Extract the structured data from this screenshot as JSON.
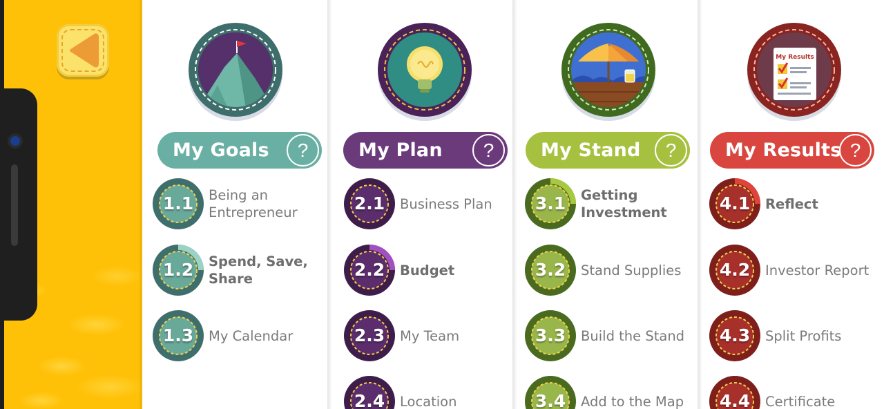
{
  "colors": {
    "sidebar_bg": "#ffc107",
    "back_button": "#fbe36b",
    "back_arrow": "#ec9b35",
    "goals": "#6aafa3",
    "plan": "#6b3a7a",
    "stand": "#a6c03f",
    "results": "#d9463f"
  },
  "sidebar": {
    "back_icon": "triangle-left-icon"
  },
  "sections": [
    {
      "title": "My Goals",
      "help_label": "?",
      "badge_icon": "mountain-flag-icon",
      "lessons": [
        {
          "number": "1.1",
          "label": "Being an Entrepreneur",
          "bold": false,
          "progress": 0
        },
        {
          "number": "1.2",
          "label": "Spend, Save, Share",
          "bold": true,
          "progress": 0.25
        },
        {
          "number": "1.3",
          "label": "My Calendar",
          "bold": false,
          "progress": 0
        }
      ]
    },
    {
      "title": "My Plan",
      "help_label": "?",
      "badge_icon": "lightbulb-icon",
      "lessons": [
        {
          "number": "2.1",
          "label": "Business Plan",
          "bold": false,
          "progress": 0
        },
        {
          "number": "2.2",
          "label": "Budget",
          "bold": true,
          "progress": 0.25
        },
        {
          "number": "2.3",
          "label": "My Team",
          "bold": false,
          "progress": 0
        },
        {
          "number": "2.4",
          "label": "Location",
          "bold": false,
          "progress": 0
        }
      ]
    },
    {
      "title": "My Stand",
      "help_label": "?",
      "badge_icon": "umbrella-stand-icon",
      "lessons": [
        {
          "number": "3.1",
          "label": "Getting Investment",
          "bold": true,
          "progress": 0.25
        },
        {
          "number": "3.2",
          "label": "Stand Supplies",
          "bold": false,
          "progress": 0
        },
        {
          "number": "3.3",
          "label": "Build the Stand",
          "bold": false,
          "progress": 0
        },
        {
          "number": "3.4",
          "label": "Add to the Map",
          "bold": false,
          "progress": 0
        }
      ]
    },
    {
      "title": "My Results",
      "help_label": "?",
      "badge_icon": "results-checklist-icon",
      "badge_text": "My Results",
      "lessons": [
        {
          "number": "4.1",
          "label": "Reflect",
          "bold": true,
          "progress": 0.25
        },
        {
          "number": "4.2",
          "label": "Investor Report",
          "bold": false,
          "progress": 0
        },
        {
          "number": "4.3",
          "label": "Split Profits",
          "bold": false,
          "progress": 0
        },
        {
          "number": "4.4",
          "label": "Certificate",
          "bold": false,
          "progress": 0
        }
      ]
    }
  ]
}
